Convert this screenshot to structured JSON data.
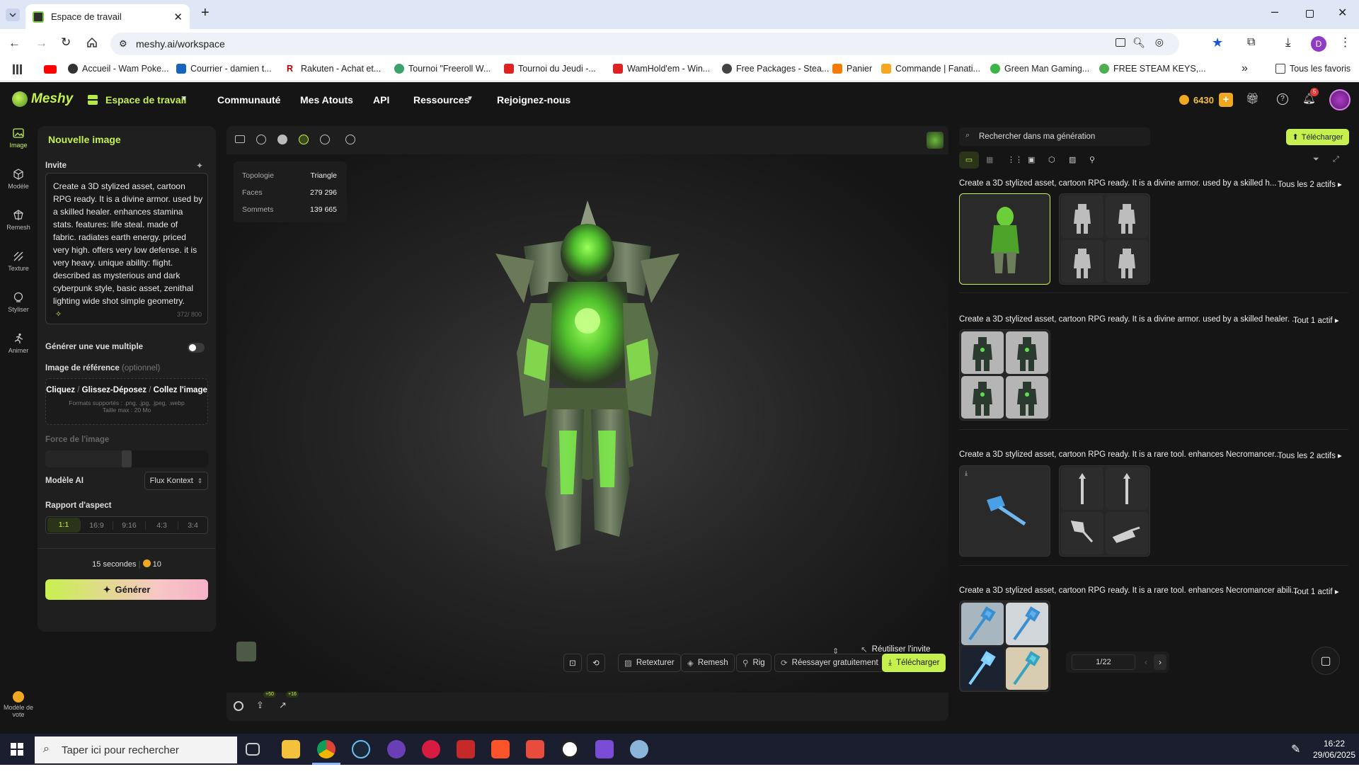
{
  "browser": {
    "tab_title": "Espace de travail",
    "url": "meshy.ai/workspace",
    "profile_initial": "D",
    "bookmarks": [
      "Accueil - Wam Poke...",
      "Courrier - damien t...",
      "Rakuten - Achat et...",
      "Tournoi \"Freeroll W...",
      "Tournoi du Jeudi -...",
      "WamHold'em - Win...",
      "Free Packages - Stea...",
      "Panier",
      "Commande | Fanati...",
      "Green Man Gaming...",
      "FREE STEAM KEYS,..."
    ],
    "all_bookmarks": "Tous les favoris"
  },
  "app": {
    "logo": "Meshy",
    "workspace_label": "Espace de travail",
    "nav": [
      "Communauté",
      "Mes Atouts",
      "API",
      "Ressources",
      "Rejoignez-nous"
    ],
    "credits": "6430",
    "notif_count": "5"
  },
  "rail": {
    "items": [
      {
        "label": "Image",
        "icon": "image-icon"
      },
      {
        "label": "Modèle",
        "icon": "cube-icon"
      },
      {
        "label": "Remesh",
        "icon": "remesh-icon"
      },
      {
        "label": "Texture",
        "icon": "texture-icon"
      },
      {
        "label": "Styliser",
        "icon": "style-icon"
      },
      {
        "label": "Animer",
        "icon": "run-icon"
      }
    ],
    "vote_label_1": "Modèle de",
    "vote_label_2": "vote"
  },
  "panel": {
    "title": "Nouvelle image",
    "prompt_label": "Invite",
    "prompt_text": "Create a 3D stylized asset, cartoon RPG ready. It is a divine armor. used by a skilled healer. enhances stamina stats. features: life steal. made of fabric. radiates earth energy. priced very high. offers very low defense. it is very heavy. unique ability: flight. described as mysterious and dark cyberpunk style, basic asset, zenithal lighting wide shot simple geometry.",
    "char_count": "372/ 800",
    "multiview_label": "Générer une vue multiple",
    "ref_label": "Image de référence",
    "ref_optional": "(optionnel)",
    "upload_cliquez": "Cliquez",
    "upload_glisser": "Glissez-Déposez",
    "upload_collez": "Collez l'image",
    "upload_formats": "Formats supportés : .png, .jpg, .jpeg, .webp",
    "upload_size": "Taille max : 20 Mo",
    "strength_label": "Force de l'image",
    "strength_value": 0.5,
    "model_label": "Modèle AI",
    "model_value": "Flux Kontext",
    "aspect_label": "Rapport d'aspect",
    "aspects": [
      "1:1",
      "16:9",
      "9:16",
      "4:3",
      "3:4"
    ],
    "time": "15 secondes",
    "cost": "10",
    "generate": "Générer"
  },
  "viewer": {
    "stats": [
      {
        "k": "Topologie",
        "v": "Triangle"
      },
      {
        "k": "Faces",
        "v": "279 296"
      },
      {
        "k": "Sommets",
        "v": "139 665"
      }
    ],
    "reuse": "Réutiliser l'invite",
    "badge1": "+50",
    "badge2": "+16",
    "buttons": {
      "retexture": "Retexturer",
      "remesh": "Remesh",
      "rig": "Rig",
      "retry": "Réessayer gratuitement",
      "download": "Télécharger"
    }
  },
  "right": {
    "search_placeholder": "Rechercher dans ma génération",
    "download": "Télécharger",
    "rows": [
      {
        "title": "Create a 3D stylized asset, cartoon RPG ready. It is a divine armor. used by a skilled h...",
        "link": "Tous les 2 actifs"
      },
      {
        "title": "Create a 3D stylized asset, cartoon RPG ready. It is a divine armor. used by a skilled healer. ...",
        "link": "Tout 1 actif"
      },
      {
        "title": "Create a 3D stylized asset, cartoon RPG ready. It is a rare tool. enhances Necromancer...",
        "link": "Tous les 2 actifs"
      },
      {
        "title": "Create a 3D stylized asset, cartoon RPG ready. It is a rare tool. enhances Necromancer abili...",
        "link": "Tout 1 actif"
      }
    ],
    "page": "1/22"
  },
  "taskbar": {
    "search": "Taper ici pour rechercher",
    "time": "16:22",
    "date": "29/06/2025"
  }
}
